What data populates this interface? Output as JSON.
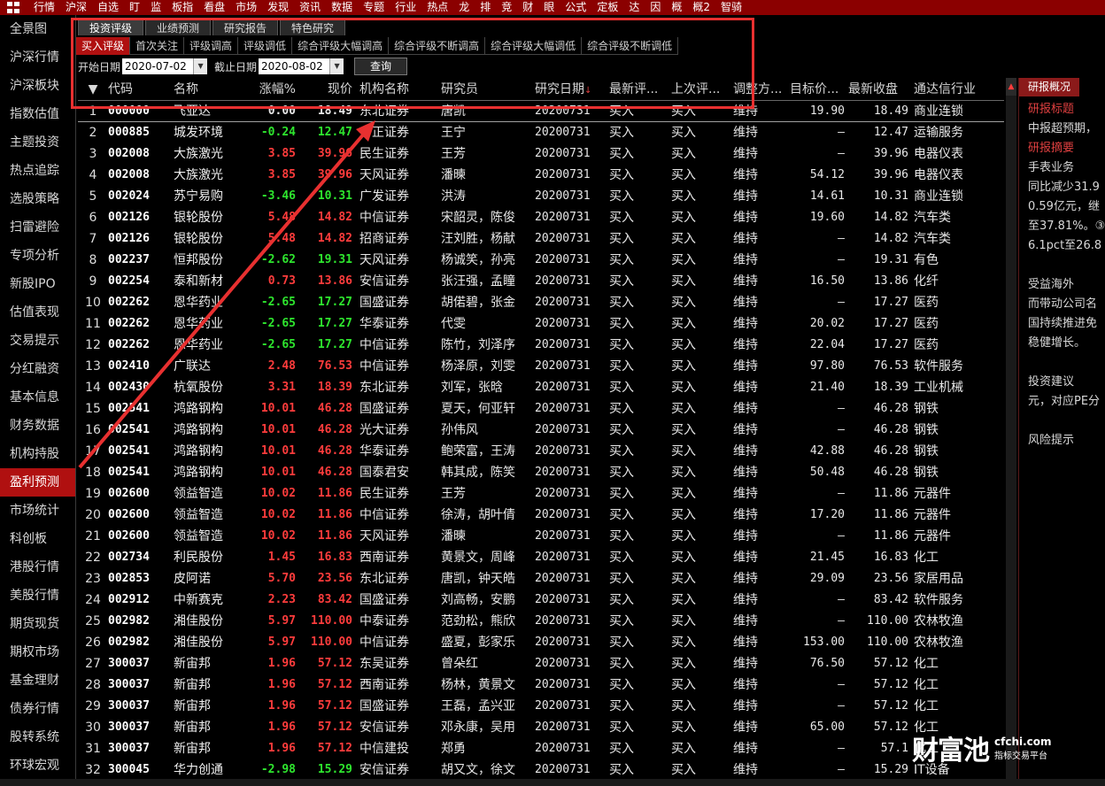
{
  "topbar": {
    "items": [
      "行情",
      "沪深",
      "自选",
      "盯",
      "监",
      "板指",
      "看盘",
      "市场",
      "发现",
      "资讯",
      "数据",
      "专题",
      "行业",
      "热点",
      "龙",
      "排",
      "竞",
      "财",
      "眼",
      "公式",
      "定板",
      "达",
      "因",
      "概",
      "概2",
      "智骑"
    ]
  },
  "sidebar": {
    "items": [
      "全景图",
      "沪深行情",
      "沪深板块",
      "指数估值",
      "主题投资",
      "热点追踪",
      "选股策略",
      "扫雷避险",
      "专项分析",
      "新股IPO",
      "估值表现",
      "交易提示",
      "分红融资",
      "基本信息",
      "财务数据",
      "机构持股",
      "盈利预测",
      "市场统计",
      "科创板",
      "港股行情",
      "美股行情",
      "期货现货",
      "期权市场",
      "基金理财",
      "债券行情",
      "股转系统",
      "环球宏观"
    ],
    "active_index": 16
  },
  "tabs_primary": [
    "投资评级",
    "业绩预测",
    "研究报告",
    "特色研究"
  ],
  "tabs_secondary": [
    "买入评级",
    "首次关注",
    "评级调高",
    "评级调低",
    "综合评级大幅调高",
    "综合评级不断调高",
    "综合评级大幅调低",
    "综合评级不断调低"
  ],
  "filter": {
    "start_label": "开始日期",
    "start_value": "2020-07-02",
    "end_label": "截止日期",
    "end_value": "2020-08-02",
    "query_label": "查询"
  },
  "table": {
    "headers": {
      "sort_arrow": "▼",
      "code": "代码",
      "name": "名称",
      "chg": "涨幅%",
      "price": "现价",
      "org": "机构名称",
      "analyst": "研究员",
      "date": "研究日期",
      "date_sort": "↓",
      "rate": "最新评...",
      "prev": "上次评...",
      "adj": "调整方...",
      "target": "目标价...",
      "close": "最新收盘",
      "ind": "通达信行业"
    },
    "rows": [
      {
        "idx": "1",
        "code": "000000",
        "name": "飞亚达",
        "chg": "0.00",
        "price": "18.49",
        "org": "东北证券",
        "analyst": "唐凯",
        "date": "20200731",
        "rate": "买入",
        "prev": "买入",
        "adj": "维持",
        "target": "19.90",
        "close": "18.49",
        "ind": "商业连锁",
        "dir": "flat"
      },
      {
        "idx": "2",
        "code": "000885",
        "name": "城发环境",
        "chg": "-0.24",
        "price": "12.47",
        "org": "方正证券",
        "analyst": "王宁",
        "date": "20200731",
        "rate": "买入",
        "prev": "买入",
        "adj": "维持",
        "target": "–",
        "close": "12.47",
        "ind": "运输服务",
        "dir": "down"
      },
      {
        "idx": "3",
        "code": "002008",
        "name": "大族激光",
        "chg": "3.85",
        "price": "39.96",
        "org": "民生证券",
        "analyst": "王芳",
        "date": "20200731",
        "rate": "买入",
        "prev": "买入",
        "adj": "维持",
        "target": "–",
        "close": "39.96",
        "ind": "电器仪表",
        "dir": "up"
      },
      {
        "idx": "4",
        "code": "002008",
        "name": "大族激光",
        "chg": "3.85",
        "price": "39.96",
        "org": "天风证券",
        "analyst": "潘暕",
        "date": "20200731",
        "rate": "买入",
        "prev": "买入",
        "adj": "维持",
        "target": "54.12",
        "close": "39.96",
        "ind": "电器仪表",
        "dir": "up"
      },
      {
        "idx": "5",
        "code": "002024",
        "name": "苏宁易购",
        "chg": "-3.46",
        "price": "10.31",
        "org": "广发证券",
        "analyst": "洪涛",
        "date": "20200731",
        "rate": "买入",
        "prev": "买入",
        "adj": "维持",
        "target": "14.61",
        "close": "10.31",
        "ind": "商业连锁",
        "dir": "down"
      },
      {
        "idx": "6",
        "code": "002126",
        "name": "银轮股份",
        "chg": "5.48",
        "price": "14.82",
        "org": "中信证券",
        "analyst": "宋韶灵，陈俊",
        "date": "20200731",
        "rate": "买入",
        "prev": "买入",
        "adj": "维持",
        "target": "19.60",
        "close": "14.82",
        "ind": "汽车类",
        "dir": "up"
      },
      {
        "idx": "7",
        "code": "002126",
        "name": "银轮股份",
        "chg": "5.48",
        "price": "14.82",
        "org": "招商证券",
        "analyst": "汪刘胜，杨献",
        "date": "20200731",
        "rate": "买入",
        "prev": "买入",
        "adj": "维持",
        "target": "–",
        "close": "14.82",
        "ind": "汽车类",
        "dir": "up"
      },
      {
        "idx": "8",
        "code": "002237",
        "name": "恒邦股份",
        "chg": "-2.62",
        "price": "19.31",
        "org": "天风证券",
        "analyst": "杨诚笑，孙亮",
        "date": "20200731",
        "rate": "买入",
        "prev": "买入",
        "adj": "维持",
        "target": "–",
        "close": "19.31",
        "ind": "有色",
        "dir": "down"
      },
      {
        "idx": "9",
        "code": "002254",
        "name": "泰和新材",
        "chg": "0.73",
        "price": "13.86",
        "org": "安信证券",
        "analyst": "张汪强，孟瞳",
        "date": "20200731",
        "rate": "买入",
        "prev": "买入",
        "adj": "维持",
        "target": "16.50",
        "close": "13.86",
        "ind": "化纤",
        "dir": "up"
      },
      {
        "idx": "10",
        "code": "002262",
        "name": "恩华药业",
        "chg": "-2.65",
        "price": "17.27",
        "org": "国盛证券",
        "analyst": "胡偌碧，张金",
        "date": "20200731",
        "rate": "买入",
        "prev": "买入",
        "adj": "维持",
        "target": "–",
        "close": "17.27",
        "ind": "医药",
        "dir": "down"
      },
      {
        "idx": "11",
        "code": "002262",
        "name": "恩华药业",
        "chg": "-2.65",
        "price": "17.27",
        "org": "华泰证券",
        "analyst": "代雯",
        "date": "20200731",
        "rate": "买入",
        "prev": "买入",
        "adj": "维持",
        "target": "20.02",
        "close": "17.27",
        "ind": "医药",
        "dir": "down"
      },
      {
        "idx": "12",
        "code": "002262",
        "name": "恩华药业",
        "chg": "-2.65",
        "price": "17.27",
        "org": "中信证券",
        "analyst": "陈竹，刘泽序",
        "date": "20200731",
        "rate": "买入",
        "prev": "买入",
        "adj": "维持",
        "target": "22.04",
        "close": "17.27",
        "ind": "医药",
        "dir": "down"
      },
      {
        "idx": "13",
        "code": "002410",
        "name": "广联达",
        "chg": "2.48",
        "price": "76.53",
        "org": "中信证券",
        "analyst": "杨泽原，刘雯",
        "date": "20200731",
        "rate": "买入",
        "prev": "买入",
        "adj": "维持",
        "target": "97.80",
        "close": "76.53",
        "ind": "软件服务",
        "dir": "up"
      },
      {
        "idx": "14",
        "code": "002430",
        "name": "杭氧股份",
        "chg": "3.31",
        "price": "18.39",
        "org": "东北证券",
        "analyst": "刘军，张晗",
        "date": "20200731",
        "rate": "买入",
        "prev": "买入",
        "adj": "维持",
        "target": "21.40",
        "close": "18.39",
        "ind": "工业机械",
        "dir": "up"
      },
      {
        "idx": "15",
        "code": "002541",
        "name": "鸿路钢构",
        "chg": "10.01",
        "price": "46.28",
        "org": "国盛证券",
        "analyst": "夏天，何亚轩",
        "date": "20200731",
        "rate": "买入",
        "prev": "买入",
        "adj": "维持",
        "target": "–",
        "close": "46.28",
        "ind": "钢铁",
        "dir": "up"
      },
      {
        "idx": "16",
        "code": "002541",
        "name": "鸿路钢构",
        "chg": "10.01",
        "price": "46.28",
        "org": "光大证券",
        "analyst": "孙伟风",
        "date": "20200731",
        "rate": "买入",
        "prev": "买入",
        "adj": "维持",
        "target": "–",
        "close": "46.28",
        "ind": "钢铁",
        "dir": "up"
      },
      {
        "idx": "17",
        "code": "002541",
        "name": "鸿路钢构",
        "chg": "10.01",
        "price": "46.28",
        "org": "华泰证券",
        "analyst": "鲍荣富，王涛",
        "date": "20200731",
        "rate": "买入",
        "prev": "买入",
        "adj": "维持",
        "target": "42.88",
        "close": "46.28",
        "ind": "钢铁",
        "dir": "up"
      },
      {
        "idx": "18",
        "code": "002541",
        "name": "鸿路钢构",
        "chg": "10.01",
        "price": "46.28",
        "org": "国泰君安",
        "analyst": "韩其成，陈笑",
        "date": "20200731",
        "rate": "买入",
        "prev": "买入",
        "adj": "维持",
        "target": "50.48",
        "close": "46.28",
        "ind": "钢铁",
        "dir": "up"
      },
      {
        "idx": "19",
        "code": "002600",
        "name": "领益智造",
        "chg": "10.02",
        "price": "11.86",
        "org": "民生证券",
        "analyst": "王芳",
        "date": "20200731",
        "rate": "买入",
        "prev": "买入",
        "adj": "维持",
        "target": "–",
        "close": "11.86",
        "ind": "元器件",
        "dir": "up"
      },
      {
        "idx": "20",
        "code": "002600",
        "name": "领益智造",
        "chg": "10.02",
        "price": "11.86",
        "org": "中信证券",
        "analyst": "徐涛，胡叶倩",
        "date": "20200731",
        "rate": "买入",
        "prev": "买入",
        "adj": "维持",
        "target": "17.20",
        "close": "11.86",
        "ind": "元器件",
        "dir": "up"
      },
      {
        "idx": "21",
        "code": "002600",
        "name": "领益智造",
        "chg": "10.02",
        "price": "11.86",
        "org": "天风证券",
        "analyst": "潘暕",
        "date": "20200731",
        "rate": "买入",
        "prev": "买入",
        "adj": "维持",
        "target": "–",
        "close": "11.86",
        "ind": "元器件",
        "dir": "up"
      },
      {
        "idx": "22",
        "code": "002734",
        "name": "利民股份",
        "chg": "1.45",
        "price": "16.83",
        "org": "西南证券",
        "analyst": "黄景文，周峰",
        "date": "20200731",
        "rate": "买入",
        "prev": "买入",
        "adj": "维持",
        "target": "21.45",
        "close": "16.83",
        "ind": "化工",
        "dir": "up"
      },
      {
        "idx": "23",
        "code": "002853",
        "name": "皮阿诺",
        "chg": "5.70",
        "price": "23.56",
        "org": "东北证券",
        "analyst": "唐凯，钟天皓",
        "date": "20200731",
        "rate": "买入",
        "prev": "买入",
        "adj": "维持",
        "target": "29.09",
        "close": "23.56",
        "ind": "家居用品",
        "dir": "up"
      },
      {
        "idx": "24",
        "code": "002912",
        "name": "中新赛克",
        "chg": "2.23",
        "price": "83.42",
        "org": "国盛证券",
        "analyst": "刘高畅，安鹏",
        "date": "20200731",
        "rate": "买入",
        "prev": "买入",
        "adj": "维持",
        "target": "–",
        "close": "83.42",
        "ind": "软件服务",
        "dir": "up"
      },
      {
        "idx": "25",
        "code": "002982",
        "name": "湘佳股份",
        "chg": "5.97",
        "price": "110.00",
        "org": "中泰证券",
        "analyst": "范劲松，熊欣",
        "date": "20200731",
        "rate": "买入",
        "prev": "买入",
        "adj": "维持",
        "target": "–",
        "close": "110.00",
        "ind": "农林牧渔",
        "dir": "up"
      },
      {
        "idx": "26",
        "code": "002982",
        "name": "湘佳股份",
        "chg": "5.97",
        "price": "110.00",
        "org": "中信证券",
        "analyst": "盛夏，彭家乐",
        "date": "20200731",
        "rate": "买入",
        "prev": "买入",
        "adj": "维持",
        "target": "153.00",
        "close": "110.00",
        "ind": "农林牧渔",
        "dir": "up"
      },
      {
        "idx": "27",
        "code": "300037",
        "name": "新宙邦",
        "chg": "1.96",
        "price": "57.12",
        "org": "东吴证券",
        "analyst": "曾朵红",
        "date": "20200731",
        "rate": "买入",
        "prev": "买入",
        "adj": "维持",
        "target": "76.50",
        "close": "57.12",
        "ind": "化工",
        "dir": "up"
      },
      {
        "idx": "28",
        "code": "300037",
        "name": "新宙邦",
        "chg": "1.96",
        "price": "57.12",
        "org": "西南证券",
        "analyst": "杨林，黄景文",
        "date": "20200731",
        "rate": "买入",
        "prev": "买入",
        "adj": "维持",
        "target": "–",
        "close": "57.12",
        "ind": "化工",
        "dir": "up"
      },
      {
        "idx": "29",
        "code": "300037",
        "name": "新宙邦",
        "chg": "1.96",
        "price": "57.12",
        "org": "国盛证券",
        "analyst": "王磊，孟兴亚",
        "date": "20200731",
        "rate": "买入",
        "prev": "买入",
        "adj": "维持",
        "target": "–",
        "close": "57.12",
        "ind": "化工",
        "dir": "up"
      },
      {
        "idx": "30",
        "code": "300037",
        "name": "新宙邦",
        "chg": "1.96",
        "price": "57.12",
        "org": "安信证券",
        "analyst": "邓永康，吴用",
        "date": "20200731",
        "rate": "买入",
        "prev": "买入",
        "adj": "维持",
        "target": "65.00",
        "close": "57.12",
        "ind": "化工",
        "dir": "up"
      },
      {
        "idx": "31",
        "code": "300037",
        "name": "新宙邦",
        "chg": "1.96",
        "price": "57.12",
        "org": "中信建投",
        "analyst": "郑勇",
        "date": "20200731",
        "rate": "买入",
        "prev": "买入",
        "adj": "维持",
        "target": "–",
        "close": "57.1",
        "ind": "化工",
        "dir": "up"
      },
      {
        "idx": "32",
        "code": "300045",
        "name": "华力创通",
        "chg": "-2.98",
        "price": "15.29",
        "org": "安信证券",
        "analyst": "胡又文，徐文",
        "date": "20200731",
        "rate": "买入",
        "prev": "买入",
        "adj": "维持",
        "target": "–",
        "close": "15.29",
        "ind": "IT设备",
        "dir": "down"
      }
    ]
  },
  "right_panel": {
    "tab": "研报概况",
    "lines": [
      {
        "text": "研报标题",
        "hd": true
      },
      {
        "text": "中报超预期，",
        "hd": false
      },
      {
        "text": "研报摘要",
        "hd": true
      },
      {
        "text": "    手表业务",
        "hd": false
      },
      {
        "text": "同比减少31.9",
        "hd": false
      },
      {
        "text": "0.59亿元，继",
        "hd": false
      },
      {
        "text": "至37.81%。③",
        "hd": false
      },
      {
        "text": "6.1pct至26.8",
        "hd": false
      },
      {
        "text": "",
        "hd": false
      },
      {
        "text": "    受益海外",
        "hd": false
      },
      {
        "text": "而带动公司名",
        "hd": false
      },
      {
        "text": "国持续推进免",
        "hd": false
      },
      {
        "text": "稳健增长。",
        "hd": false
      },
      {
        "text": "",
        "hd": false
      },
      {
        "text": "    投资建议",
        "hd": false
      },
      {
        "text": "元，对应PE分",
        "hd": false
      },
      {
        "text": "",
        "hd": false
      },
      {
        "text": "    风险提示",
        "hd": false
      }
    ]
  },
  "watermark": {
    "brand": "财富池",
    "site": "cfchi.com",
    "sub": "指标交易平台"
  },
  "colors": {
    "up": "#ff3c3c",
    "down": "#2ee62e",
    "accent": "#b01010",
    "annotation": "#e83030"
  }
}
